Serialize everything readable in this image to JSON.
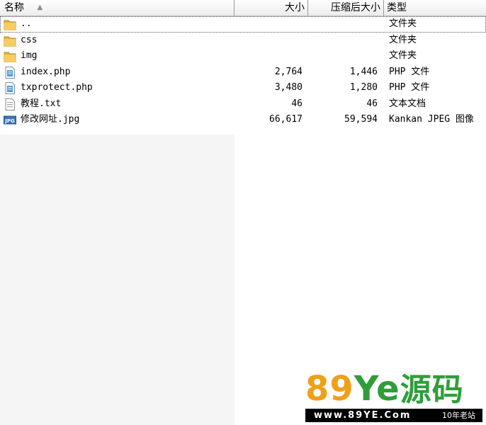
{
  "columns": {
    "name": "名称",
    "size": "大小",
    "compressed": "压缩后大小",
    "type": "类型"
  },
  "files": [
    {
      "name": "..",
      "size": "",
      "compressed": "",
      "type": "文件夹",
      "icon": "folder-icon"
    },
    {
      "name": "css",
      "size": "",
      "compressed": "",
      "type": "文件夹",
      "icon": "folder-icon"
    },
    {
      "name": "img",
      "size": "",
      "compressed": "",
      "type": "文件夹",
      "icon": "folder-icon"
    },
    {
      "name": "index.php",
      "size": "2,764",
      "compressed": "1,446",
      "type": "PHP 文件",
      "icon": "php-file-icon"
    },
    {
      "name": "txprotect.php",
      "size": "3,480",
      "compressed": "1,280",
      "type": "PHP 文件",
      "icon": "php-file-icon"
    },
    {
      "name": "教程.txt",
      "size": "46",
      "compressed": "46",
      "type": "文本文档",
      "icon": "text-file-icon"
    },
    {
      "name": "修改网址.jpg",
      "size": "66,617",
      "compressed": "59,594",
      "type": "Kankan JPEG 图像",
      "icon": "jpg-file-icon"
    }
  ],
  "watermark": {
    "logo_num": "89",
    "logo_ye": "Ye",
    "logo_cn": "源码",
    "url": "www.89YE.Com",
    "tag": "10年老站"
  },
  "colors": {
    "folder": "#e8b13a",
    "watermark_orange": "#f0a016",
    "watermark_green": "#2f9e3a"
  }
}
